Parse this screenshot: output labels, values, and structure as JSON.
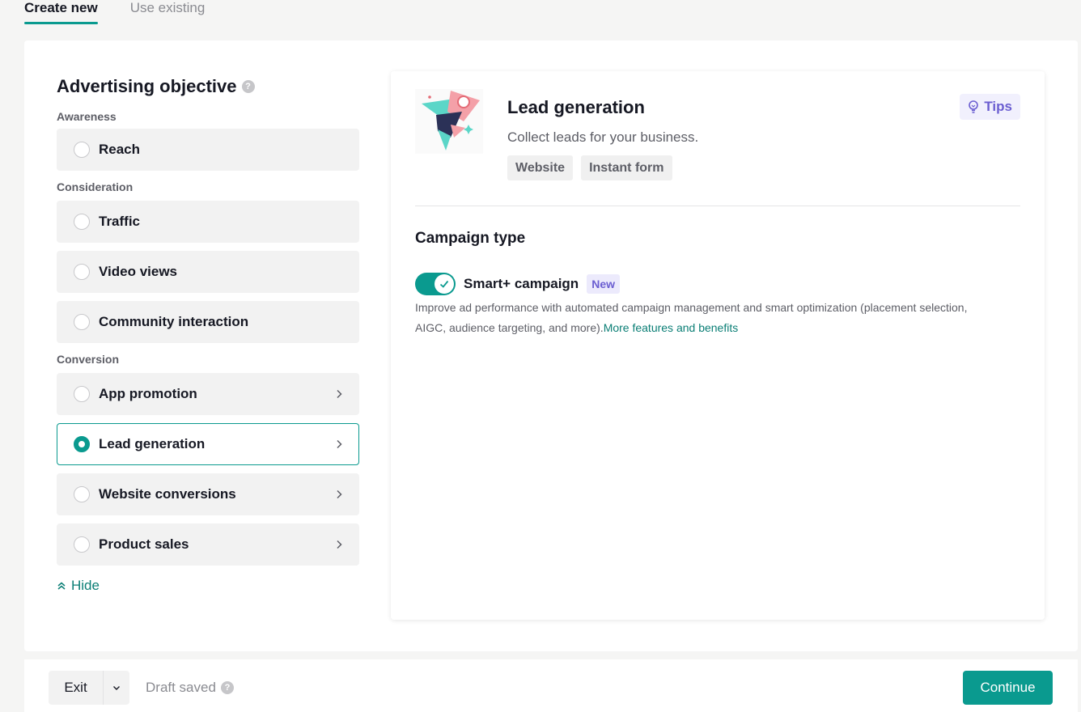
{
  "tabs": [
    {
      "label": "Create new",
      "active": true
    },
    {
      "label": "Use existing",
      "active": false
    }
  ],
  "objective": {
    "title": "Advertising objective",
    "groups": {
      "awareness": "Awareness",
      "consideration": "Consideration",
      "conversion": "Conversion"
    },
    "options": {
      "reach": "Reach",
      "traffic": "Traffic",
      "video_views": "Video views",
      "community_interaction": "Community interaction",
      "app_promotion": "App promotion",
      "lead_generation": "Lead generation",
      "website_conversions": "Website conversions",
      "product_sales": "Product sales"
    },
    "selected": "lead_generation",
    "hide_label": "Hide"
  },
  "detail": {
    "title": "Lead generation",
    "description": "Collect leads for your business.",
    "tags": [
      "Website",
      "Instant form"
    ],
    "tips_label": "Tips",
    "campaign_type_title": "Campaign type",
    "smart_label": "Smart+ campaign",
    "smart_enabled": true,
    "new_badge": "New",
    "smart_description": "Improve ad performance with automated campaign management and smart optimization (placement selection, AIGC, audience targeting, and more).",
    "more_link": "More features and benefits"
  },
  "footer": {
    "exit_label": "Exit",
    "draft_label": "Draft saved",
    "continue_label": "Continue"
  },
  "colors": {
    "accent": "#0a9a8f",
    "link": "#0a7e75",
    "tips": "#6b5ed1"
  }
}
